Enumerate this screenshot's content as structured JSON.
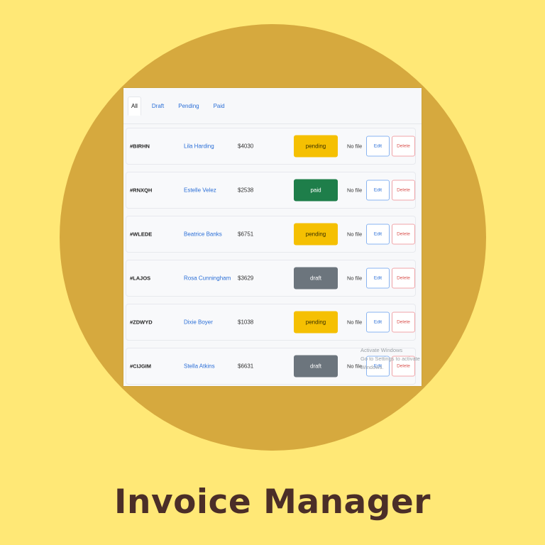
{
  "caption": "Invoice Manager",
  "tabs": [
    {
      "label": "All"
    },
    {
      "label": "Draft"
    },
    {
      "label": "Pending"
    },
    {
      "label": "Paid"
    }
  ],
  "status_colors": {
    "pending": "#F5C002",
    "paid": "#1E7E4A",
    "draft": "#6C757D"
  },
  "invoices": [
    {
      "id": "#BIRHN",
      "client": "Lila Harding",
      "amount": "$4030",
      "status": "pending",
      "file": "No file",
      "edit_label": "Edit",
      "delete_label": "Delete"
    },
    {
      "id": "#RNXQH",
      "client": "Estelle Velez",
      "amount": "$2538",
      "status": "paid",
      "file": "No file",
      "edit_label": "Edit",
      "delete_label": "Delete"
    },
    {
      "id": "#WLEDE",
      "client": "Beatrice Banks",
      "amount": "$6751",
      "status": "pending",
      "file": "No file",
      "edit_label": "Edit",
      "delete_label": "Delete"
    },
    {
      "id": "#LAJOS",
      "client": "Rosa Cunningham",
      "amount": "$3629",
      "status": "draft",
      "file": "No file",
      "edit_label": "Edit",
      "delete_label": "Delete"
    },
    {
      "id": "#ZDWYD",
      "client": "Dixie Boyer",
      "amount": "$1038",
      "status": "pending",
      "file": "No file",
      "edit_label": "Edit",
      "delete_label": "Delete"
    },
    {
      "id": "#CIJGIM",
      "client": "Stella Atkins",
      "amount": "$6631",
      "status": "draft",
      "file": "No file",
      "edit_label": "Edit",
      "delete_label": "Delete"
    }
  ],
  "watermark": {
    "line1": "Activate Windows",
    "line2": "Go to Settings to activate Windows."
  }
}
